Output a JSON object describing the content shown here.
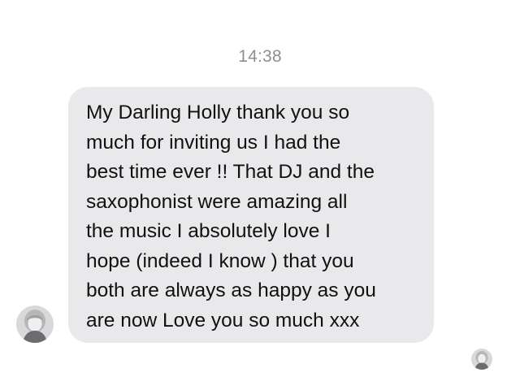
{
  "conversation": {
    "timestamp": "14:38",
    "message": {
      "text": "My Darling Holly thank you so\nmuch for inviting us I had the\nbest time ever !! That DJ and the\nsaxophonist were amazing all\nthe music I absolutely love I\nhope (indeed I know ) that you\nboth are always as happy as you\nare now Love you so much xxx"
    },
    "sender_avatar_icon": "avatar-photo-icon",
    "read_receipt_icon": "avatar-read-receipt-icon"
  },
  "colors": {
    "bubble_background": "#e9e9eb",
    "timestamp_text": "#8e8e93",
    "message_text": "#111111"
  }
}
